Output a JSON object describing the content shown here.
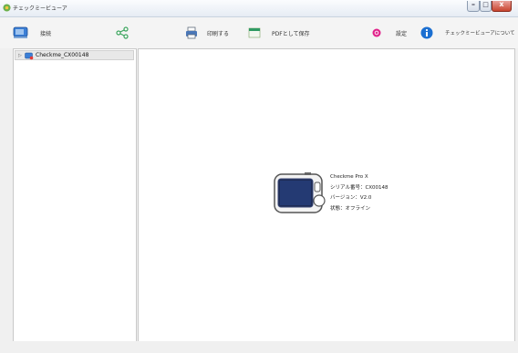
{
  "window": {
    "title": "チェックミービューア"
  },
  "toolbar": {
    "items": [
      {
        "label": "接続",
        "icon": "device-icon"
      },
      {
        "label": "",
        "icon": "share-icon"
      },
      {
        "label": "印刷する",
        "icon": "printer-icon"
      },
      {
        "label": "PDFとして保存",
        "icon": "pdf-icon"
      },
      {
        "label": "設定",
        "icon": "settings-icon"
      },
      {
        "label": "チェックミービューアについて",
        "icon": "info-icon"
      }
    ]
  },
  "tree": {
    "device_name": "Checkme_CX00148"
  },
  "device_info": {
    "model": "Checkme Pro X",
    "serial": "シリアル番号：CX00148",
    "version": "バージョン：V2.0",
    "status": "状態：オフライン"
  },
  "colors": {
    "accent": "#1b6fd1",
    "share_green": "#3aa35c",
    "close_red": "#c8452f"
  }
}
